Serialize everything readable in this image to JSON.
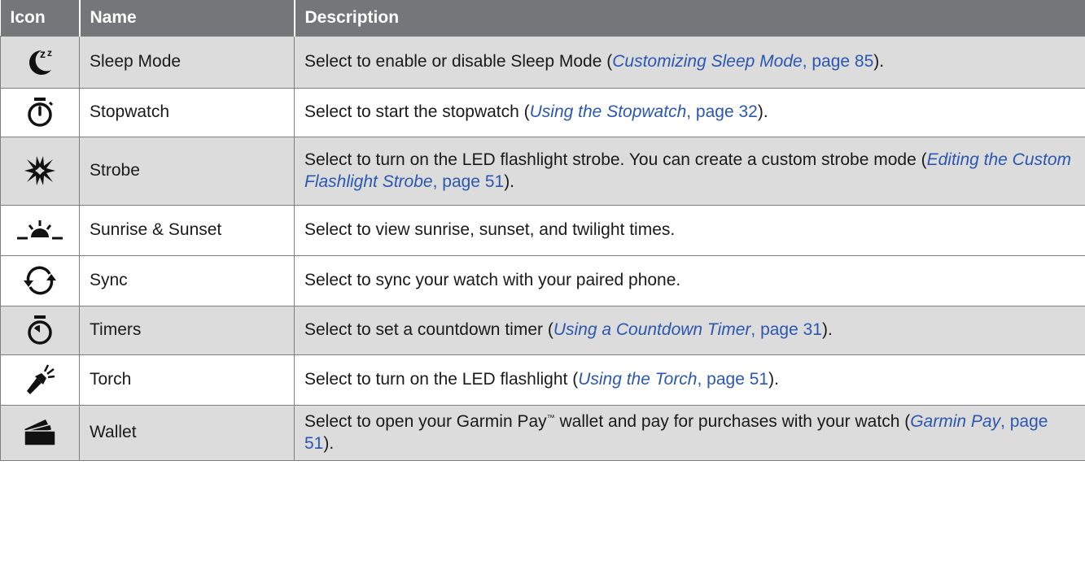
{
  "table": {
    "headers": {
      "icon": "Icon",
      "name": "Name",
      "description": "Description"
    },
    "rows": [
      {
        "icon": "sleep-mode-icon",
        "name": "Sleep Mode",
        "desc_before": "Select to enable or disable Sleep Mode (",
        "link_title": "Customizing Sleep Mode",
        "link_page": ", page 85",
        "desc_after": ")."
      },
      {
        "icon": "stopwatch-icon",
        "name": "Stopwatch",
        "desc_before": "Select to start the stopwatch (",
        "link_title": "Using the Stopwatch",
        "link_page": ", page 32",
        "desc_after": ")."
      },
      {
        "icon": "strobe-icon",
        "name": "Strobe",
        "desc_before": "Select to turn on the LED flashlight strobe. You can create a custom strobe mode (",
        "link_title": "Editing the Custom Flashlight Strobe",
        "link_page": ", page 51",
        "desc_after": ")."
      },
      {
        "icon": "sunrise-sunset-icon",
        "name": "Sunrise & Sunset",
        "desc_before": "Select to view sunrise, sunset, and twilight times."
      },
      {
        "icon": "sync-icon",
        "name": "Sync",
        "desc_before": "Select to sync your watch with your paired phone."
      },
      {
        "icon": "timer-icon",
        "name": "Timers",
        "desc_before": "Select to set a countdown timer (",
        "link_title": "Using a Countdown Timer",
        "link_page": ", page 31",
        "desc_after": ")."
      },
      {
        "icon": "torch-icon",
        "name": "Torch",
        "desc_before": "Select to turn on the LED flashlight (",
        "link_title": "Using the Torch",
        "link_page": ", page 51",
        "desc_after": ")."
      },
      {
        "icon": "wallet-icon",
        "name": "Wallet",
        "desc_before": "Select to open your Garmin Pay",
        "trademark": "™",
        "desc_mid": " wallet and pay for purchases with your watch (",
        "link_title": "Garmin Pay",
        "link_page": ", page 51",
        "desc_after": ")."
      }
    ]
  }
}
